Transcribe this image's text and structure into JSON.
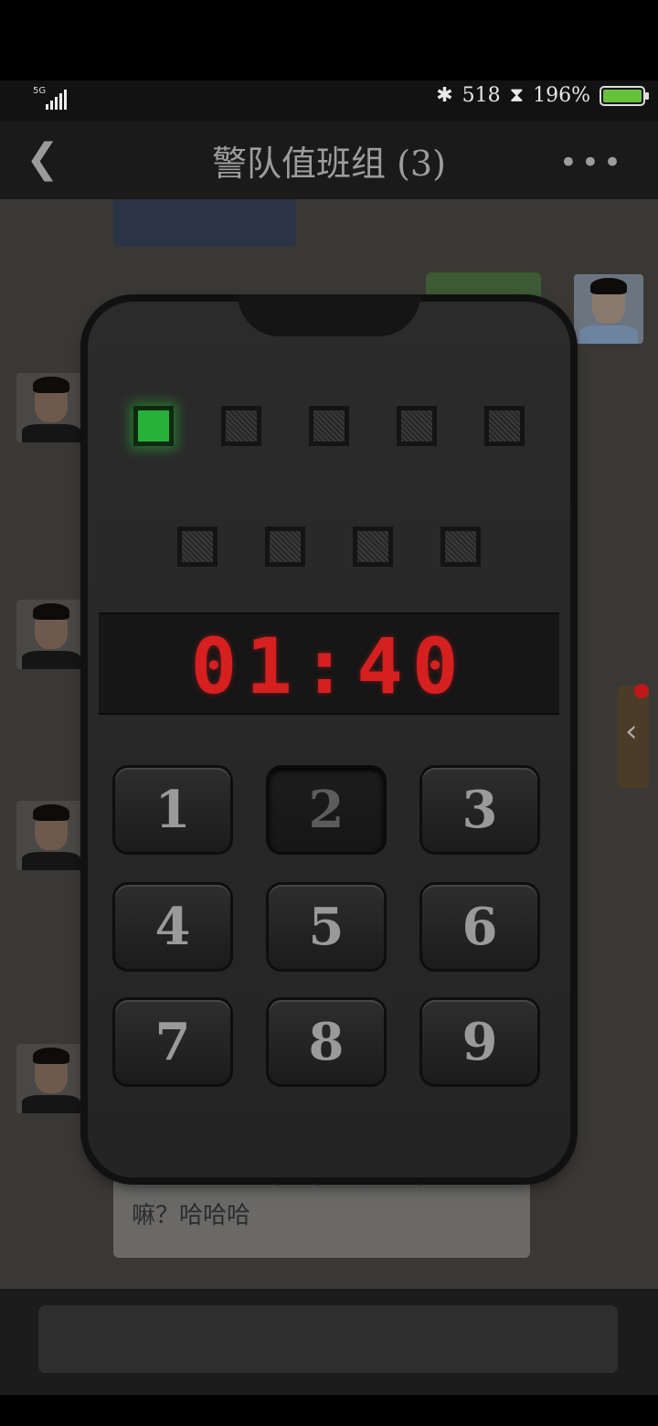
{
  "status": {
    "network": "5G",
    "steps": "518",
    "battery": "196%",
    "battery_level": 1.0
  },
  "nav": {
    "title": "警队值班组 (3)",
    "back_icon": "back-arrow-icon",
    "more_icon": "more-icon"
  },
  "chat": {
    "green_preview": "“",
    "last_message": "也算是解脱了，我们都开心，不是嘛？哈哈哈"
  },
  "device": {
    "leds_row1": [
      true,
      false,
      false,
      false,
      false
    ],
    "leds_row2": [
      false,
      false,
      false,
      false
    ],
    "timer": "01:40",
    "keys": [
      "1",
      "2",
      "3",
      "4",
      "5",
      "6",
      "7",
      "8",
      "9"
    ],
    "pressed_key": "2",
    "colors": {
      "led_on": "#27b13a",
      "timer": "#d62020"
    }
  }
}
